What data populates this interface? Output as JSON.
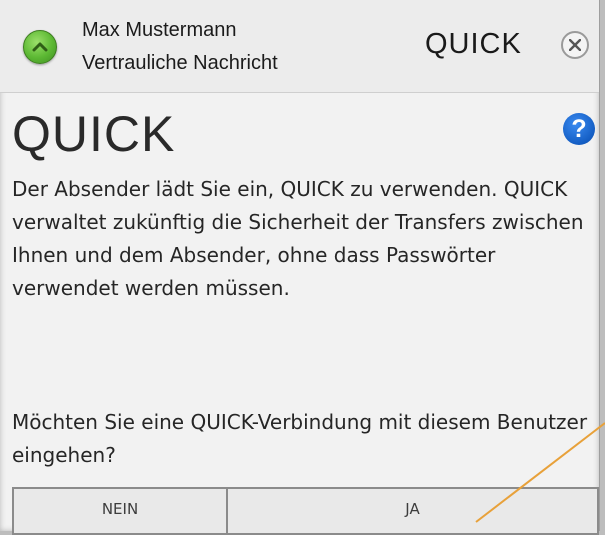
{
  "header": {
    "sender_name": "Max Mustermann",
    "subtitle": "Vertrauliche Nachricht",
    "logo": "QUICK",
    "collapse_icon": "chevron-up-icon",
    "close_icon": "close-icon"
  },
  "main": {
    "logo": "QUICK",
    "help_label": "?",
    "invitation_text": "Der Absender lädt Sie ein, QUICK zu verwenden. QUICK verwaltet zukünftig die Sicherheit der Transfers zwischen Ihnen und dem Absender, ohne dass Passwörter verwendet werden müssen.",
    "question_text": "Möchten Sie eine QUICK-Verbindung mit diesem Benutzer eingehen?"
  },
  "buttons": {
    "no_label": "NEIN",
    "yes_label": "JA"
  },
  "colors": {
    "accent_green": "#5cb833",
    "help_blue": "#145ec4",
    "callout_line": "#e8a13a"
  }
}
